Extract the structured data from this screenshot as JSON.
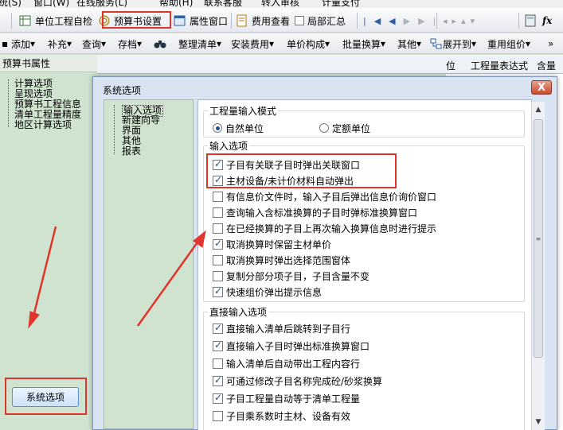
{
  "menubar": {
    "items": [
      "统(S)",
      "窗口(W)",
      "在线服务(L)",
      "帮助(H)",
      "联系客服",
      "转入审核",
      "计量支付"
    ]
  },
  "toolbar1": {
    "unit_check": "单位工程自检",
    "budget_settings": "预算书设置",
    "property_window": "属性窗口",
    "fee_view": "费用查看",
    "partial_summary": "局部汇总"
  },
  "toolbar2": {
    "items": [
      "添加",
      "补充",
      "查询",
      "存档",
      "整理清单",
      "安装费用",
      "单价构成",
      "批量换算",
      "其他",
      "展开到",
      "重用组价"
    ]
  },
  "left_panel": {
    "title": "预算书属性",
    "items": [
      "计算选项",
      "呈现选项",
      "预算书工程信息",
      "清单工程量精度",
      "地区计算选项"
    ],
    "system_options_button": "系统选项"
  },
  "grid_header": {
    "cols": [
      "位",
      "工程量表达式",
      "含量"
    ]
  },
  "dialog": {
    "title": "系统选项",
    "close_label": "X",
    "nav": [
      "输入选项",
      "新建向导",
      "界面",
      "其他",
      "报表"
    ],
    "group1": {
      "title": "工程量输入模式",
      "radio1": "自然单位",
      "radio2": "定额单位",
      "selected": "自然单位"
    },
    "group2": {
      "title": "输入选项",
      "options": [
        {
          "label": "子目有关联子目时弹出关联窗口",
          "checked": true
        },
        {
          "label": "主材设备/未计价材料自动弹出",
          "checked": true
        },
        {
          "label": "有信息价文件时，输入子目后弹出信息价询价窗口",
          "checked": false
        },
        {
          "label": "查询输入含标准换算的子目时弹标准换算窗口",
          "checked": false
        },
        {
          "label": "在已经换算的子目上再次输入换算信息时进行提示",
          "checked": false
        },
        {
          "label": "取消换算时保留主材单价",
          "checked": true
        },
        {
          "label": "取消换算时弹出选择范围窗体",
          "checked": false
        },
        {
          "label": "复制分部分项子目，子目含量不变",
          "checked": false
        },
        {
          "label": "快速组价弹出提示信息",
          "checked": true
        }
      ]
    },
    "group3": {
      "title": "直接输入选项",
      "options": [
        {
          "label": "直接输入清单后跳转到子目行",
          "checked": true
        },
        {
          "label": "直接输入子目时弹出标准换算窗口",
          "checked": true
        },
        {
          "label": "输入清单后自动带出工程内容行",
          "checked": false
        },
        {
          "label": "可通过修改子目名称完成砼/砂浆换算",
          "checked": true
        },
        {
          "label": "子目工程量自动等于清单工程量",
          "checked": true
        },
        {
          "label": "子目乘系数时主材、设备有效",
          "checked": false
        }
      ]
    }
  },
  "colors": {
    "highlight_red": "#e0342c",
    "panel_green": "#cfe3ce",
    "check_blue": "#1a4fa0"
  }
}
